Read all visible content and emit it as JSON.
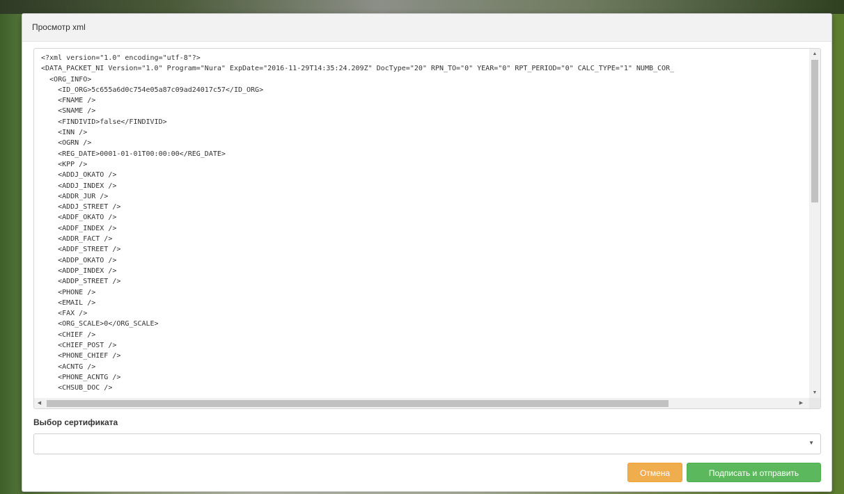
{
  "modal": {
    "title": "Просмотр xml",
    "xml_lines": [
      "<?xml version=\"1.0\" encoding=\"utf-8\"?>",
      "<DATA_PACKET_NI Version=\"1.0\" Program=\"Nura\" ExpDate=\"2016-11-29T14:35:24.209Z\" DocType=\"20\" RPN_TO=\"0\" YEAR=\"0\" RPT_PERIOD=\"0\" CALC_TYPE=\"1\" NUMB_COR_",
      "  <ORG_INFO>",
      "    <ID_ORG>5c655a6d0c754e05a87c09ad24017c57</ID_ORG>",
      "    <FNAME />",
      "    <SNAME />",
      "    <FINDIVID>false</FINDIVID>",
      "    <INN />",
      "    <OGRN />",
      "    <REG_DATE>0001-01-01T00:00:00</REG_DATE>",
      "    <KPP />",
      "    <ADDJ_OKATO />",
      "    <ADDJ_INDEX />",
      "    <ADDR_JUR />",
      "    <ADDJ_STREET />",
      "    <ADDF_OKATO />",
      "    <ADDF_INDEX />",
      "    <ADDR_FACT />",
      "    <ADDF_STREET />",
      "    <ADDP_OKATO />",
      "    <ADDP_INDEX />",
      "    <ADDP_STREET />",
      "    <PHONE />",
      "    <EMAIL />",
      "    <FAX />",
      "    <ORG_SCALE>0</ORG_SCALE>",
      "    <CHIEF />",
      "    <CHIEF_POST />",
      "    <PHONE_CHIEF />",
      "    <ACNTG />",
      "    <PHONE_ACNTG />",
      "    <CHSUB_DOC />"
    ]
  },
  "certificate": {
    "label": "Выбор сертификата",
    "selected": ""
  },
  "buttons": {
    "cancel": "Отмена",
    "submit": "Подписать и отправить"
  },
  "colors": {
    "cancel_bg": "#f0ad4e",
    "submit_bg": "#5cb85c"
  }
}
